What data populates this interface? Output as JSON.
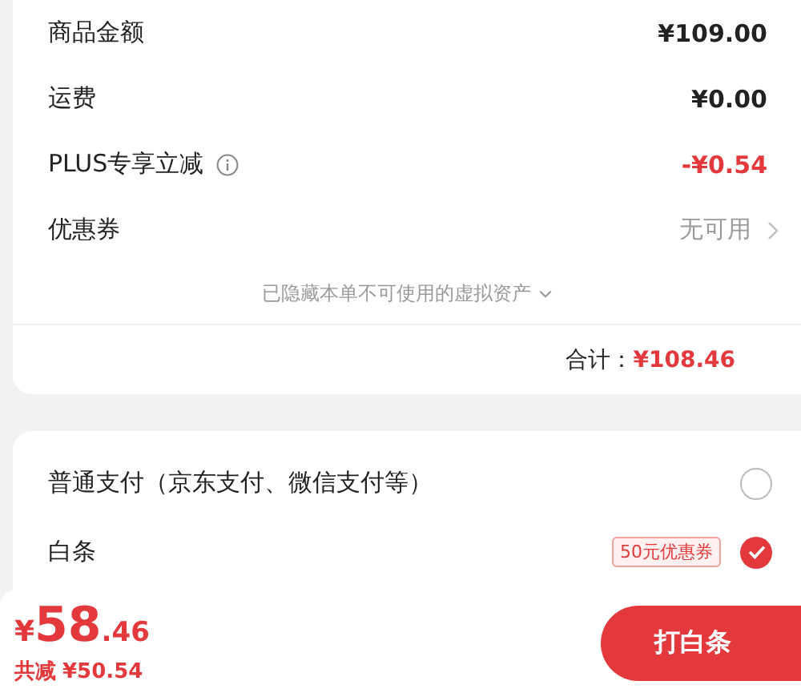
{
  "summary": {
    "rows": [
      {
        "label": "商品金额",
        "value": "¥109.00",
        "kind": "plain",
        "info": false
      },
      {
        "label": "运费",
        "value": "¥0.00",
        "kind": "plain",
        "info": false
      },
      {
        "label": "PLUS专享立减",
        "value": "-¥0.54",
        "kind": "discount",
        "info": true
      },
      {
        "label": "优惠券",
        "value": "无可用",
        "kind": "link",
        "info": false
      }
    ],
    "hidden_note": "已隐藏本单不可使用的虚拟资产",
    "total": {
      "label": "合计：",
      "value": "¥108.46"
    }
  },
  "payment": {
    "options": [
      {
        "label": "普通支付（京东支付、微信支付等）",
        "selected": false
      },
      {
        "label": "白条",
        "selected": true,
        "badge": "50元优惠券"
      }
    ]
  },
  "bottom_bar": {
    "currency": "¥",
    "integer": "58",
    "decimal": ".46",
    "savings_label": "共减",
    "savings": "¥50.54",
    "button": "打白条"
  }
}
